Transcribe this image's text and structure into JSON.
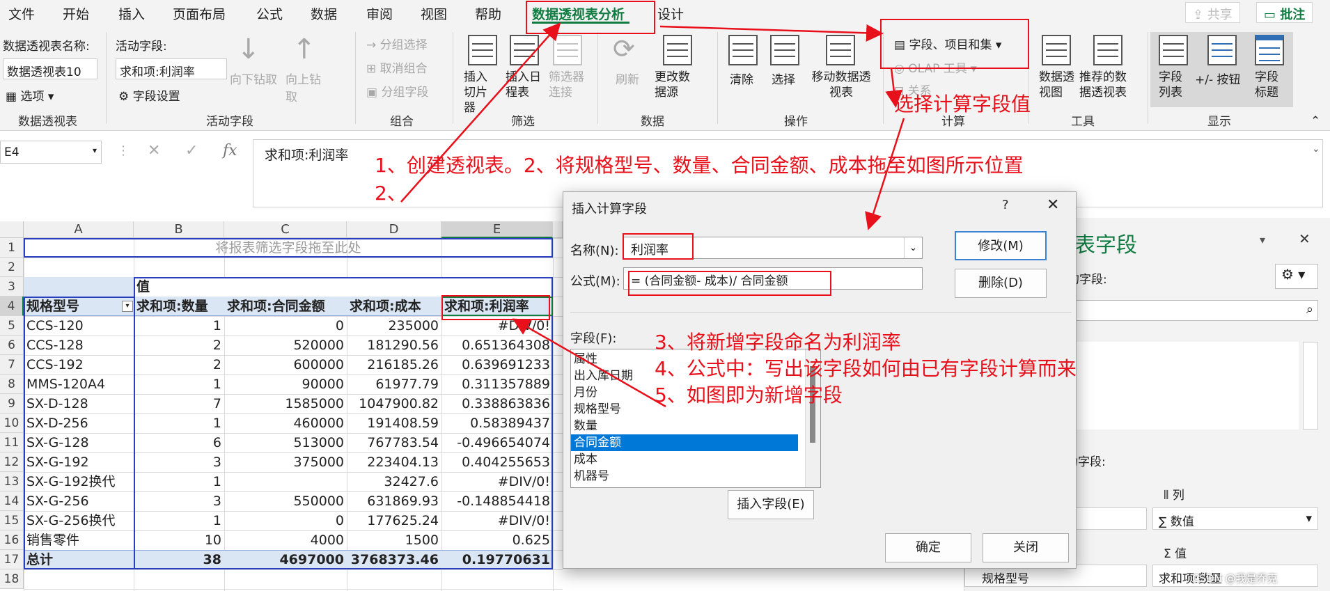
{
  "menu": {
    "items": [
      "文件",
      "开始",
      "插入",
      "页面布局",
      "公式",
      "数据",
      "审阅",
      "视图",
      "帮助",
      "数据透视表分析",
      "设计"
    ],
    "active": "数据透视表分析",
    "share": "共享",
    "comment": "批注"
  },
  "ribbon": {
    "pivot_name_label": "数据透视表名称:",
    "pivot_name_value": "数据透视表10",
    "options": "选项",
    "group_pivot": "数据透视表",
    "active_field_label": "活动字段:",
    "active_field_value": "求和项:利润率",
    "field_settings": "字段设置",
    "drill_down": "向下钻取",
    "drill_up": "向上钻取",
    "group_active_field": "活动字段",
    "group_selection": "分组选择",
    "ungroup": "取消组合",
    "group_field": "分组字段",
    "group_group": "组合",
    "insert_slicer": "插入切片器",
    "insert_timeline": "插入日程表",
    "filter_connections": "筛选器连接",
    "group_filter": "筛选",
    "refresh": "刷新",
    "change_source": "更改数据源",
    "group_data": "数据",
    "clear": "清除",
    "select": "选择",
    "move_pivot": "移动数据透视表",
    "group_actions": "操作",
    "fields_items_sets": "字段、项目和集",
    "olap_tools": "OLAP 工具",
    "relationships": "关系",
    "group_calc": "计算",
    "pivot_chart": "数据透视图",
    "recommended_pivot": "推荐的数据透视表",
    "group_tools": "工具",
    "field_list": "字段列表",
    "plus_minus": "+/- 按钮",
    "field_headers": "字段标题",
    "group_show": "显示"
  },
  "formula_bar": {
    "name_box": "E4",
    "fx": "fx",
    "content": "求和项:利润率"
  },
  "sheet": {
    "columns": [
      "A",
      "B",
      "C",
      "D",
      "E"
    ],
    "rows": [
      "1",
      "2",
      "3",
      "4",
      "5",
      "6",
      "7",
      "8",
      "9",
      "10",
      "11",
      "12",
      "13",
      "14",
      "15",
      "16",
      "17",
      "18"
    ],
    "filter_drop": "将报表筛选字段拖至此处",
    "values_label": "值",
    "headers": [
      "规格型号",
      "求和项:数量",
      "求和项:合同金额",
      "求和项:成本",
      "求和项:利润率"
    ],
    "data": [
      [
        "CCS-120",
        "1",
        "0",
        "235000",
        "#DIV/0!"
      ],
      [
        "CCS-128",
        "2",
        "520000",
        "181290.56",
        "0.651364308"
      ],
      [
        "CCS-192",
        "2",
        "600000",
        "216185.26",
        "0.639691233"
      ],
      [
        "MMS-120A4",
        "1",
        "90000",
        "61977.79",
        "0.311357889"
      ],
      [
        "SX-D-128",
        "7",
        "1585000",
        "1047900.82",
        "0.338863836"
      ],
      [
        "SX-D-256",
        "1",
        "460000",
        "191408.59",
        "0.58389437"
      ],
      [
        "SX-G-128",
        "6",
        "513000",
        "767783.54",
        "-0.496654074"
      ],
      [
        "SX-G-192",
        "3",
        "375000",
        "223404.13",
        "0.404255653"
      ],
      [
        "SX-G-192换代",
        "1",
        "",
        "32427.6",
        "#DIV/0!"
      ],
      [
        "SX-G-256",
        "3",
        "550000",
        "631869.93",
        "-0.148854418"
      ],
      [
        "SX-G-256换代",
        "1",
        "0",
        "177625.24",
        "#DIV/0!"
      ],
      [
        "销售零件",
        "10",
        "4000",
        "1500",
        "0.625"
      ]
    ],
    "total": [
      "总计",
      "38",
      "4697000",
      "3768373.46",
      "0.19770631"
    ]
  },
  "dialog": {
    "title": "插入计算字段",
    "help": "?",
    "name_label": "名称(N):",
    "name_value": "利润率",
    "formula_label": "公式(M):",
    "formula_value": "= (合同金额- 成本)/ 合同金额",
    "modify": "修改(M)",
    "delete": "删除(D)",
    "fields_label": "字段(F):",
    "fields": [
      "属性",
      "出入库日期",
      "月份",
      "规格型号",
      "数量",
      "合同金额",
      "成本",
      "机器号"
    ],
    "selected_field": "合同金额",
    "insert_field": "插入字段(E)",
    "ok": "确定",
    "close": "关闭"
  },
  "pane": {
    "title": "表字段",
    "choose_fields": "的字段:",
    "areas_hint": "动字段:",
    "columns_label": "列",
    "columns_value": "∑ 数值",
    "values_label": "值",
    "values_value": "求和项:数量",
    "rows_value": "规格型号"
  },
  "annotations": {
    "a1": "1、创建透视表。2、将规格型号、数量、合同金额、成本拖至如图所示位置",
    "a2": "2、",
    "a3": "选择计算字段值",
    "a4": "3、将新增字段命名为利润率",
    "a5": "4、公式中：写出该字段如何由已有字段计算而来",
    "a6": "5、如图即为新增字段"
  },
  "watermark": "CSDN @我是乔克"
}
